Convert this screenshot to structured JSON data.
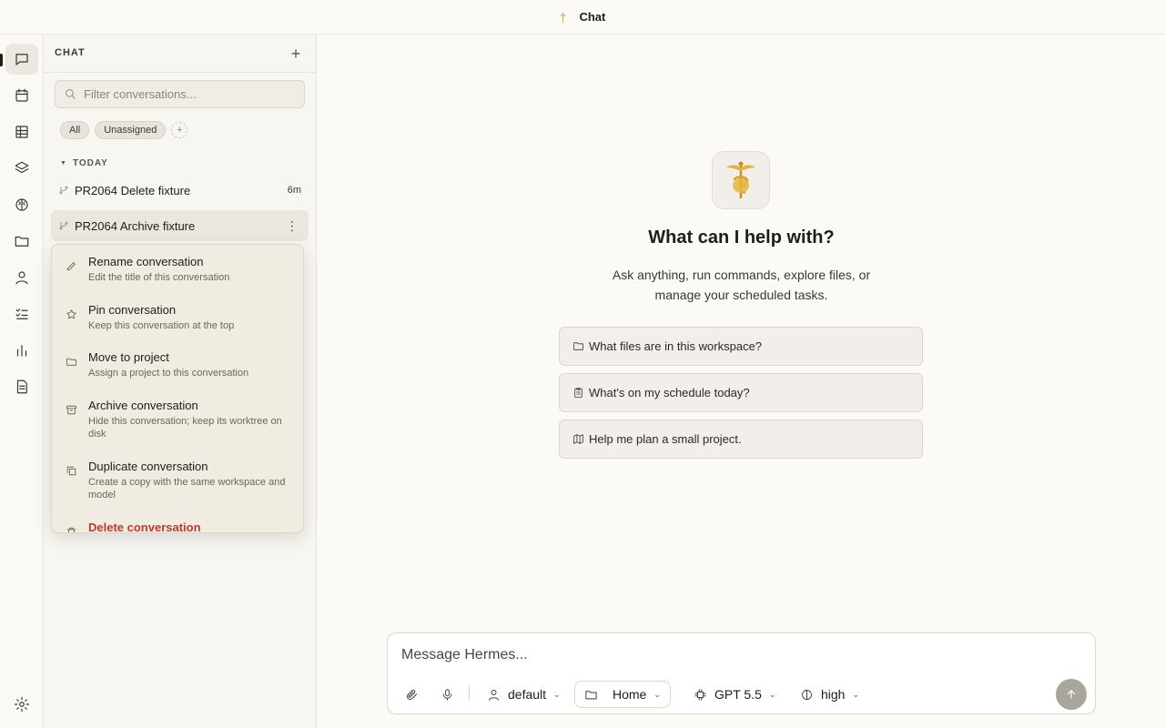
{
  "window": {
    "title": "Chat"
  },
  "rail": {
    "items": [
      {
        "name": "chat",
        "active": true
      },
      {
        "name": "calendar"
      },
      {
        "name": "table"
      },
      {
        "name": "layers"
      },
      {
        "name": "brain"
      },
      {
        "name": "folder"
      },
      {
        "name": "person"
      },
      {
        "name": "tasks"
      },
      {
        "name": "chart"
      },
      {
        "name": "document"
      },
      {
        "name": "settings"
      }
    ]
  },
  "sidebar": {
    "title": "CHAT",
    "filter_placeholder": "Filter conversations...",
    "chips": [
      "All",
      "Unassigned",
      "+"
    ],
    "section": "TODAY",
    "conversations": [
      {
        "title": "PR2064 Delete fixture",
        "time": "6m"
      },
      {
        "title": "PR2064 Archive fixture",
        "more": "⋮"
      }
    ]
  },
  "context_menu": {
    "items": [
      {
        "label": "Rename conversation",
        "desc": "Edit the title of this conversation",
        "icon": "pencil-icon"
      },
      {
        "label": "Pin conversation",
        "desc": "Keep this conversation at the top",
        "icon": "star-icon"
      },
      {
        "label": "Move to project",
        "desc": "Assign a project to this conversation",
        "icon": "folder-icon"
      },
      {
        "label": "Archive conversation",
        "desc": "Hide this conversation; keep its worktree on disk",
        "icon": "archive-icon"
      },
      {
        "label": "Duplicate conversation",
        "desc": "Create a copy with the same workspace and model",
        "icon": "copy-icon"
      },
      {
        "label": "Delete conversation",
        "icon": "trash-icon",
        "danger": true
      }
    ]
  },
  "main": {
    "heading": "What can I help with?",
    "subtitle_line1": "Ask anything, run commands, explore files, or",
    "subtitle_line2": "manage your scheduled tasks.",
    "suggestions": [
      {
        "label": "What files are in this workspace?",
        "icon": "folder-icon"
      },
      {
        "label": "What's on my schedule today?",
        "icon": "clipboard-icon"
      },
      {
        "label": "Help me plan a small project.",
        "icon": "map-icon"
      }
    ]
  },
  "composer": {
    "placeholder": "Message Hermes...",
    "profile": "default",
    "workspace": "Home",
    "model": "GPT 5.5",
    "reasoning": "high"
  },
  "colors": {
    "accent": "#d8a23a",
    "danger": "#c0392b",
    "background": "#fcfaf6"
  }
}
